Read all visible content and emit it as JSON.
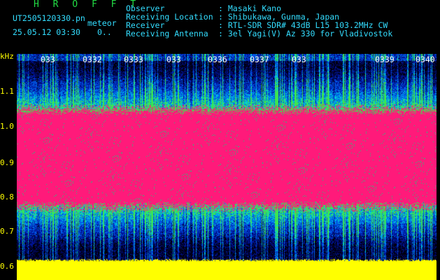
{
  "header": {
    "title": "H R O F F T",
    "file_name": "UT2505120330.pn",
    "meteor_label": "meteor",
    "date_time": "25.05.12 03:30",
    "dots": "0..",
    "fields": [
      {
        "label": "Observer",
        "value": "Masaki Kano"
      },
      {
        "label": "Receiving Location",
        "value": "Shibukawa, Gunma, Japan"
      },
      {
        "label": "Receiver",
        "value": "RTL-SDR SDR# 43dB L15 103.2MHz CW"
      },
      {
        "label": "Receiving Antenna",
        "value": "3el Yagi(V) Az 330 for Vladivostok"
      }
    ]
  },
  "colors": {
    "background": "#000000",
    "title": "#22dd44",
    "header_text": "#33ddff",
    "axis": "#ffff00",
    "tick": "#ffffff",
    "signal": "#ff1a7a",
    "floor": "#ffff00"
  },
  "chart_data": {
    "type": "heatmap",
    "ylabel": "kHz",
    "y_ticks": [
      "1.1",
      "1.0",
      "0.9",
      "0.8",
      "0.7",
      "0.6"
    ],
    "x_ticks": [
      "033",
      "0332",
      "0333",
      "033",
      "0336",
      "0337",
      "033",
      "0339",
      "0340"
    ],
    "signal_band_khz": [
      0.77,
      1.05
    ],
    "floor_band_khz": [
      0.55,
      0.62
    ]
  }
}
